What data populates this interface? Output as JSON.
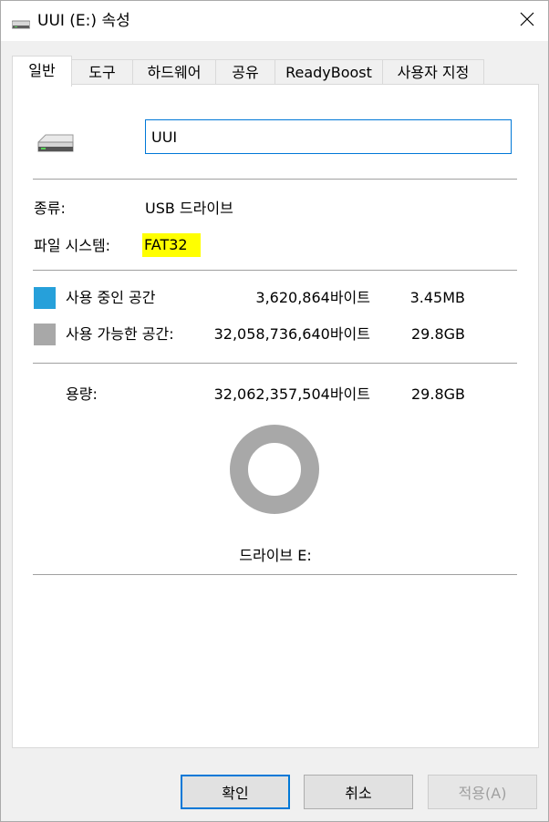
{
  "window": {
    "title": "UUI (E:) 속성",
    "close_glyph": "✕"
  },
  "tabs": [
    {
      "label": "일반",
      "active": true
    },
    {
      "label": "도구"
    },
    {
      "label": "하드웨어"
    },
    {
      "label": "공유"
    },
    {
      "label": "ReadyBoost"
    },
    {
      "label": "사용자 지정"
    }
  ],
  "general": {
    "drive_name": "UUI",
    "type_label": "종류:",
    "type_value": "USB 드라이브",
    "fs_label": "파일 시스템:",
    "fs_value": "FAT32",
    "used_label": "사용 중인 공간",
    "used_bytes": "3,620,864바이트",
    "used_size": "3.45MB",
    "free_label": "사용 가능한 공간:",
    "free_bytes": "32,058,736,640바이트",
    "free_size": "29.8GB",
    "capacity_label": "용량:",
    "capacity_bytes": "32,062,357,504바이트",
    "capacity_size": "29.8GB",
    "drive_label": "드라이브 E:"
  },
  "colors": {
    "used": "#26a0da",
    "free": "#a8a8a8",
    "accent": "#0078d7",
    "highlight": "#ffff00"
  },
  "buttons": {
    "ok": "확인",
    "cancel": "취소",
    "apply": "적용(A)"
  }
}
